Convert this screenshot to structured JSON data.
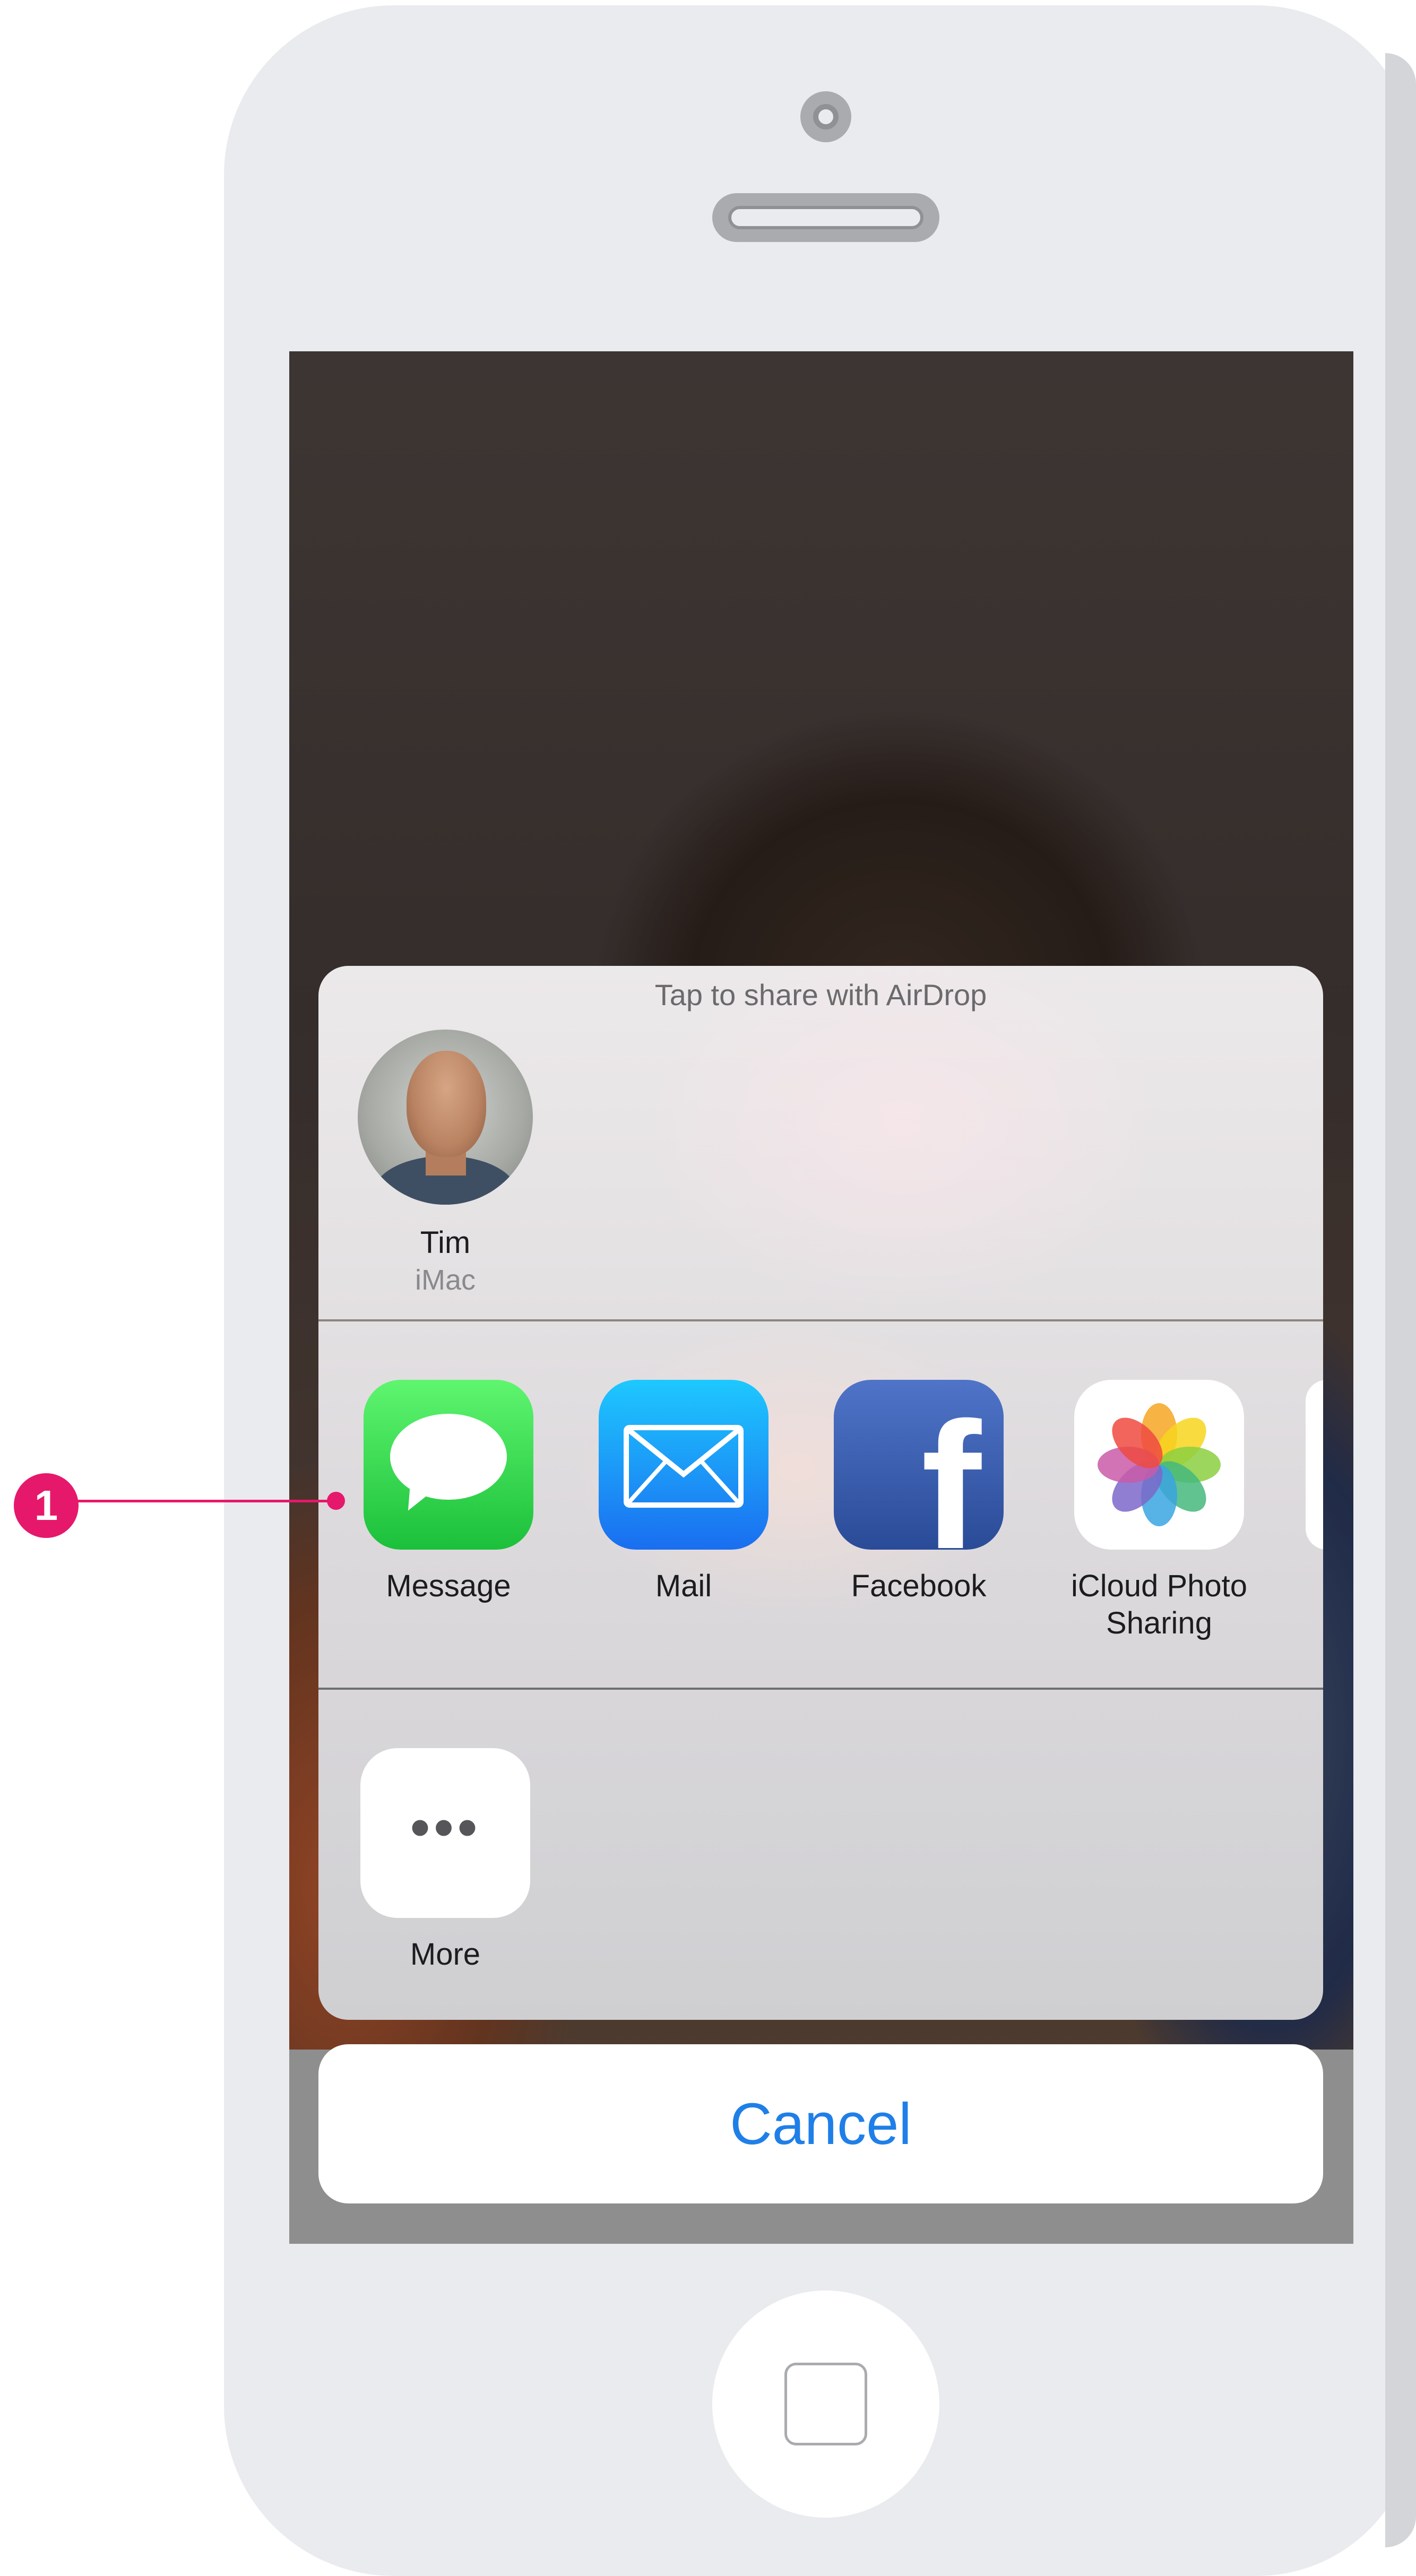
{
  "airdrop": {
    "hint": "Tap to share with AirDrop",
    "person": {
      "name": "Tim",
      "device": "iMac"
    }
  },
  "share_apps": [
    {
      "label": "Message",
      "icon": "messages-icon"
    },
    {
      "label": "Mail",
      "icon": "mail-icon"
    },
    {
      "label": "Facebook",
      "icon": "facebook-icon"
    },
    {
      "label": "iCloud Photo Sharing",
      "label_line1": "iCloud Photo",
      "label_line2": "Sharing",
      "icon": "photos-icon"
    }
  ],
  "facebook_glyph": "f",
  "more": {
    "label": "More",
    "glyph": "•••"
  },
  "cancel_label": "Cancel",
  "annotation": {
    "number": "1"
  },
  "colors": {
    "accent_blue": "#1f7fe8",
    "annotation_pink": "#e6186b",
    "messages_green": "#1bc03a",
    "mail_blue": "#1a6ef0",
    "facebook_blue": "#2a4b97"
  }
}
